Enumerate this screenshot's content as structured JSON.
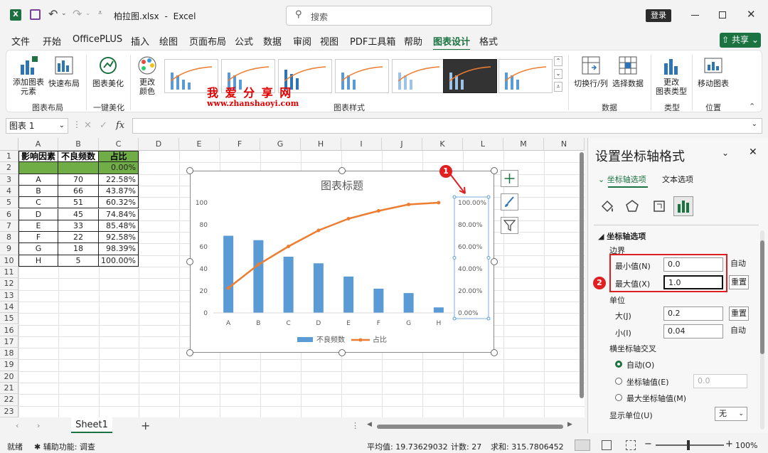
{
  "titlebar": {
    "filename": "柏拉图.xlsx",
    "separator": "-",
    "app": "Excel",
    "search_placeholder": "搜索",
    "login": "登录"
  },
  "tabs": [
    "文件",
    "开始",
    "OfficePLUS",
    "插入",
    "绘图",
    "页面布局",
    "公式",
    "数据",
    "审阅",
    "视图",
    "PDF工具箱",
    "帮助",
    "图表设计",
    "格式"
  ],
  "share_label": "共享",
  "ribbon": {
    "add_element": "添加图表\n元素",
    "quick_layout": "快速布局",
    "beautify": "图表美化",
    "change_color": "更改\n颜色",
    "switch_row_col": "切换行/列",
    "select_data": "选择数据",
    "change_type": "更改\n图表类型",
    "move_chart": "移动图表",
    "groups": {
      "layout": "图表布局",
      "one_key": "一键美化",
      "styles": "图表样式",
      "data": "数据",
      "type": "类型",
      "location": "位置"
    }
  },
  "watermark": {
    "text": "我 爱 分 享 网",
    "url": "www.zhanshaoyi.com"
  },
  "formula_bar": {
    "name_box": "图表 1",
    "fx": "fx"
  },
  "columns": [
    "A",
    "B",
    "C",
    "D",
    "E",
    "F",
    "G",
    "H",
    "I",
    "J",
    "K",
    "L",
    "M",
    "N"
  ],
  "rows": [
    "1",
    "2",
    "3",
    "4",
    "5",
    "6",
    "7",
    "8",
    "9",
    "10",
    "11",
    "12",
    "13",
    "14",
    "15",
    "16",
    "17",
    "18",
    "19",
    "20",
    "21",
    "22",
    "23"
  ],
  "table": {
    "headers": [
      "影响因素",
      "不良频数",
      "占比"
    ],
    "row2": [
      "",
      "",
      "0.00%"
    ],
    "data": [
      [
        "A",
        "70",
        "22.58%"
      ],
      [
        "B",
        "66",
        "43.87%"
      ],
      [
        "C",
        "51",
        "60.32%"
      ],
      [
        "D",
        "45",
        "74.84%"
      ],
      [
        "E",
        "33",
        "85.48%"
      ],
      [
        "F",
        "22",
        "92.58%"
      ],
      [
        "G",
        "18",
        "98.39%"
      ],
      [
        "H",
        "5",
        "100.00%"
      ]
    ]
  },
  "chart_data": {
    "type": "bar",
    "title": "图表标题",
    "categories": [
      "A",
      "B",
      "C",
      "D",
      "E",
      "F",
      "G",
      "H"
    ],
    "series": [
      {
        "name": "不良频数",
        "type": "bar",
        "values": [
          70,
          66,
          51,
          45,
          33,
          22,
          18,
          5
        ],
        "color": "#5b9bd5"
      },
      {
        "name": "占比",
        "type": "line",
        "values": [
          0.2258,
          0.4387,
          0.6032,
          0.7484,
          0.8548,
          0.9258,
          0.9839,
          1.0
        ],
        "color": "#ed7d31"
      }
    ],
    "ylim": [
      0,
      100
    ],
    "y_ticks": [
      "0",
      "20",
      "40",
      "60",
      "80",
      "100"
    ],
    "y2lim": [
      0,
      1
    ],
    "y2_ticks": [
      "0.00%",
      "20.00%",
      "40.00%",
      "60.00%",
      "80.00%",
      "100.00%"
    ],
    "legend": "bottom",
    "grid": false
  },
  "pane": {
    "title": "设置坐标轴格式",
    "tab_axis": "坐标轴选项",
    "tab_text": "文本选项",
    "section": "坐标轴选项",
    "bounds": "边界",
    "min_label": "最小值(N)",
    "min_value": "0.0",
    "min_btn": "自动",
    "max_label": "最大值(X)",
    "max_value": "1.0",
    "max_btn": "重置",
    "units": "单位",
    "major_label": "大(J)",
    "major_value": "0.2",
    "major_btn": "重置",
    "minor_label": "小(I)",
    "minor_value": "0.04",
    "minor_btn": "自动",
    "cross": "横坐标轴交叉",
    "opt_auto": "自动(O)",
    "opt_value": "坐标轴值(E)",
    "opt_value_input": "0.0",
    "opt_max": "最大坐标轴值(M)",
    "display_units": "显示单位(U)",
    "display_units_value": "无"
  },
  "annotations": [
    "1",
    "2"
  ],
  "sheet_tab": "Sheet1",
  "status": {
    "ready": "就绪",
    "accessibility": "辅助功能: 调查",
    "avg": "平均值: 19.73629032",
    "count": "计数: 27",
    "sum": "求和: 315.7806452",
    "zoom": "100%"
  }
}
